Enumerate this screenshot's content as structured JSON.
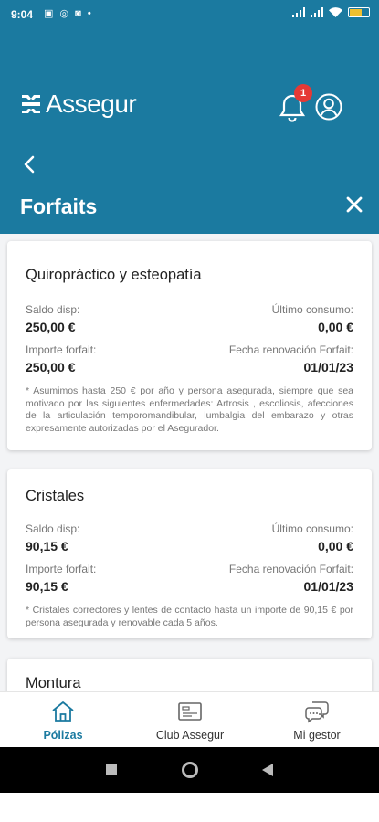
{
  "status_bar": {
    "time": "9:04",
    "left_icons": [
      "message-icon",
      "whatsapp-icon",
      "instagram-icon",
      "dot-icon"
    ],
    "right_icons": [
      "signal-icon",
      "signal-icon",
      "wifi-icon",
      "battery-icon"
    ]
  },
  "header": {
    "brand": "Assegur",
    "notifications_count": "1",
    "back_icon": "chevron-left-icon",
    "title": "Forfaits",
    "close_icon": "close-icon"
  },
  "colors": {
    "primary": "#1b7aa0",
    "badge": "#e53935",
    "nav_bar": "#000000"
  },
  "cards": [
    {
      "title": "Quiropráctico y esteopatía",
      "saldo_label": "Saldo disp:",
      "saldo_value": "250,00 €",
      "consumo_label": "Último consumo:",
      "consumo_value": "0,00 €",
      "importe_label": "Importe forfait:",
      "importe_value": "250,00 €",
      "renovacion_label": "Fecha renovación Forfait:",
      "renovacion_value": "01/01/23",
      "note": "* Asumimos hasta 250 € por año y persona asegurada, siempre que sea motivado por las siguientes enfermedades: Artrosis , escoliosis, afecciones de la articulación temporomandibular, lumbalgia del embarazo y otras expresamente autorizadas por el Asegurador."
    },
    {
      "title": "Cristales",
      "saldo_label": "Saldo disp:",
      "saldo_value": "90,15 €",
      "consumo_label": "Último consumo:",
      "consumo_value": "0,00 €",
      "importe_label": "Importe forfait:",
      "importe_value": "90,15 €",
      "renovacion_label": "Fecha renovación Forfait:",
      "renovacion_value": "01/01/23",
      "note": "* Cristales correctores y lentes de contacto hasta un importe de 90,15 € por persona asegurada y renovable cada 5 años."
    },
    {
      "title": "Montura"
    }
  ],
  "tabs": [
    {
      "label": "Pólizas",
      "icon": "home-icon",
      "active": true
    },
    {
      "label": "Club Assegur",
      "icon": "club-card-icon",
      "active": false
    },
    {
      "label": "Mi gestor",
      "icon": "chat-icon",
      "active": false
    }
  ],
  "nav_bar": [
    "recent-apps-icon",
    "home-button-icon",
    "back-triangle-icon"
  ]
}
